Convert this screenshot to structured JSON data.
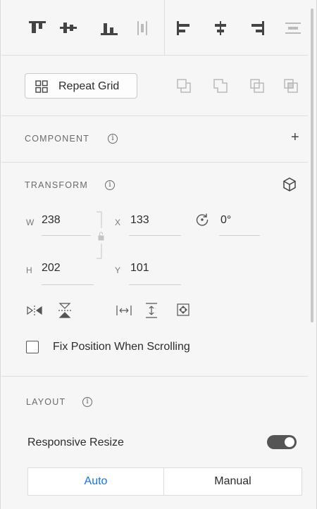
{
  "toolbar": {
    "distribute_icons": [
      "align-top-icon",
      "align-middle-icon",
      "align-bottom-icon",
      "distribute-vertical-icon"
    ],
    "align_icons": [
      "align-left-icon",
      "align-center-icon",
      "align-right-icon",
      "distribute-horizontal-icon"
    ]
  },
  "repeat_grid": {
    "label": "Repeat Grid"
  },
  "boolean_icons": [
    "subtract-icon",
    "add-icon",
    "intersect-icon",
    "exclude-icon"
  ],
  "component": {
    "title": "COMPONENT",
    "add": "+"
  },
  "transform": {
    "title": "TRANSFORM",
    "w_label": "W",
    "w_value": "238",
    "x_label": "X",
    "x_value": "133",
    "rotation_value": "0°",
    "h_label": "H",
    "h_value": "202",
    "y_label": "Y",
    "y_value": "101",
    "fix_position_label": "Fix Position When Scrolling"
  },
  "layout": {
    "title": "LAYOUT",
    "responsive_label": "Responsive Resize",
    "responsive_on": true,
    "modes": [
      "Auto",
      "Manual"
    ],
    "selected_mode": "Auto"
  },
  "colors": {
    "accent": "#1473e6",
    "toggle_on": "#555555"
  }
}
